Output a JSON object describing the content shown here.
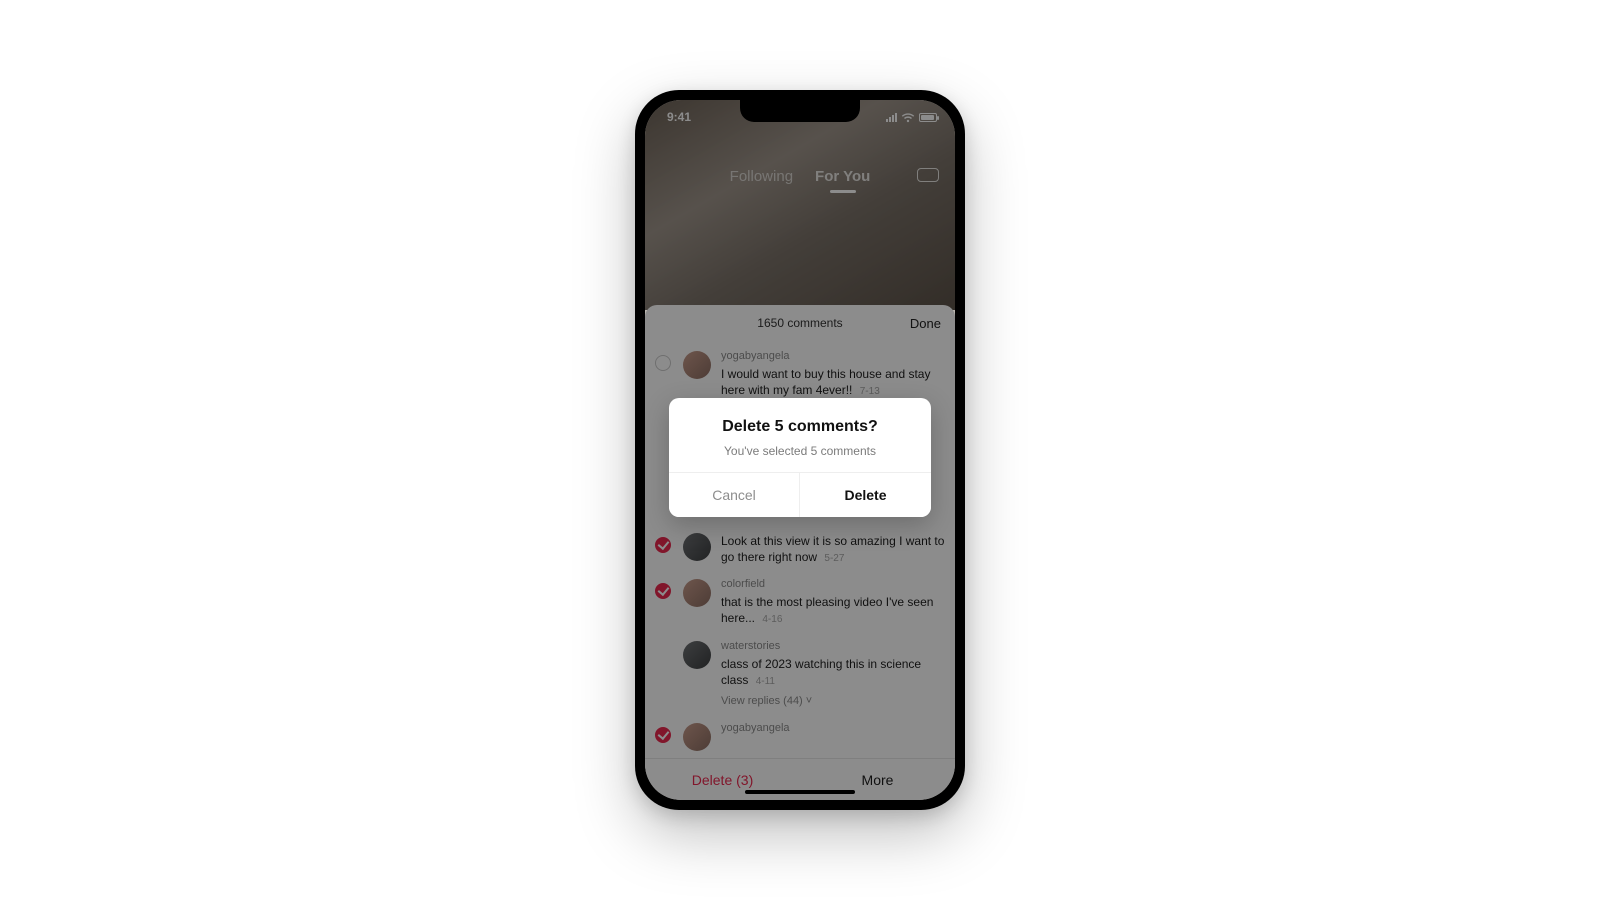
{
  "status": {
    "time": "9:41"
  },
  "feed": {
    "following": "Following",
    "for_you": "For You"
  },
  "sheet": {
    "title": "1650 comments",
    "done": "Done",
    "footer": {
      "delete": "Delete (3)",
      "more": "More"
    }
  },
  "comments": [
    {
      "selected": false,
      "avatar": "warm",
      "user": "yogabyangela",
      "text": "I would want to buy this house and stay here with my fam 4ever!!",
      "time": "7-13"
    },
    {
      "selected": true,
      "avatar": "grayish",
      "user": "",
      "text": "Look at this view it is so amazing I want to go there right now",
      "time": "5-27"
    },
    {
      "selected": true,
      "avatar": "warm",
      "user": "colorfield",
      "text": "that is the most pleasing video I've seen here...",
      "time": "4-16"
    },
    {
      "selected": false,
      "avatar": "grayish",
      "user": "waterstories",
      "text": "class of 2023 watching this in science class",
      "time": "4-11",
      "replies": "View replies (44) ˅"
    },
    {
      "selected": true,
      "avatar": "warm",
      "user": "yogabyangela",
      "text": "",
      "time": ""
    }
  ],
  "modal": {
    "title": "Delete 5 comments?",
    "subtitle": "You've selected 5 comments",
    "cancel": "Cancel",
    "confirm": "Delete"
  }
}
